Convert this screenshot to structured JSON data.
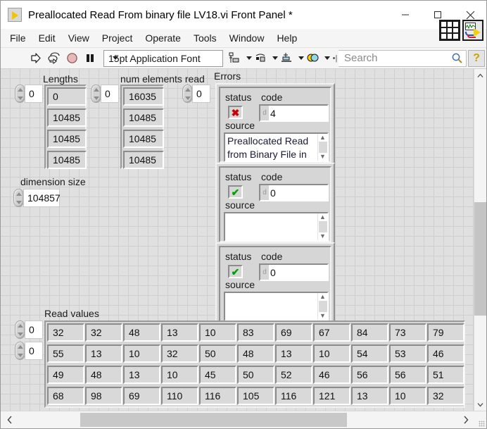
{
  "window": {
    "title": "Preallocated Read From binary file LV18.vi Front Panel *",
    "app_icon": "labview-vi-icon",
    "minimize": "minimize-icon",
    "maximize": "maximize-icon",
    "close": "close-icon"
  },
  "menubar": {
    "items": [
      {
        "label": "File"
      },
      {
        "label": "Edit"
      },
      {
        "label": "View"
      },
      {
        "label": "Project"
      },
      {
        "label": "Operate"
      },
      {
        "label": "Tools"
      },
      {
        "label": "Window"
      },
      {
        "label": "Help"
      }
    ]
  },
  "toolbar": {
    "run": "run-arrow-icon",
    "run_continuously": "run-continuously-icon",
    "abort": "abort-execution-icon",
    "pause": "pause-icon",
    "font_selector": "15pt Application Font",
    "align_objects": "align-objects-icon",
    "distribute_objects": "distribute-objects-icon",
    "resize_objects": "resize-objects-icon",
    "reorder": "reorder-icon",
    "search_placeholder": "Search",
    "search_value": "",
    "search_icon": "magnifier-icon",
    "help_label": "?"
  },
  "panel": {
    "lengths": {
      "label": "Lengths",
      "index": "0",
      "values": [
        "0",
        "10485",
        "10485",
        "10485"
      ]
    },
    "num_elements_read": {
      "label": "num elements read",
      "index": "0",
      "values": [
        "16035",
        "10485",
        "10485",
        "10485"
      ]
    },
    "num_elements_index2": "0",
    "dimension_size": {
      "label": "dimension size",
      "value": "104857"
    },
    "errors": {
      "label": "Errors",
      "clusters": [
        {
          "status_label": "status",
          "code_label": "code",
          "source_label": "source",
          "status": "error",
          "status_glyph": "✖",
          "radix": "d",
          "code": "4",
          "source": "Preallocated Read\nfrom Binary File in"
        },
        {
          "status_label": "status",
          "code_label": "code",
          "source_label": "source",
          "status": "ok",
          "status_glyph": "✔",
          "radix": "d",
          "code": "0",
          "source": ""
        },
        {
          "status_label": "status",
          "code_label": "code",
          "source_label": "source",
          "status": "ok",
          "status_glyph": "✔",
          "radix": "d",
          "code": "0",
          "source": ""
        }
      ]
    },
    "read_values": {
      "label": "Read values",
      "row_index": "0",
      "col_index": "0",
      "rows": [
        [
          "32",
          "32",
          "48",
          "13",
          "10",
          "83",
          "69",
          "67",
          "84",
          "73",
          "79"
        ],
        [
          "55",
          "13",
          "10",
          "32",
          "50",
          "48",
          "13",
          "10",
          "54",
          "53",
          "46"
        ],
        [
          "49",
          "48",
          "13",
          "10",
          "45",
          "50",
          "52",
          "46",
          "56",
          "56",
          "51"
        ],
        [
          "68",
          "98",
          "69",
          "110",
          "116",
          "105",
          "116",
          "121",
          "13",
          "10",
          "32"
        ]
      ]
    }
  },
  "scrollbars": {
    "v_up": "chevron-up-icon",
    "v_down": "chevron-down-icon",
    "h_left": "chevron-left-icon",
    "h_right": "chevron-right-icon",
    "resize_grip": "resize-grip-icon"
  },
  "colors": {
    "panel_bg": "#e0e0e0",
    "grid_line": "#cfcfcf",
    "control_face": "#d9d9d9",
    "error_red": "#cc0000",
    "ok_green": "#00a000",
    "accent_yellow": "#f5c400"
  }
}
